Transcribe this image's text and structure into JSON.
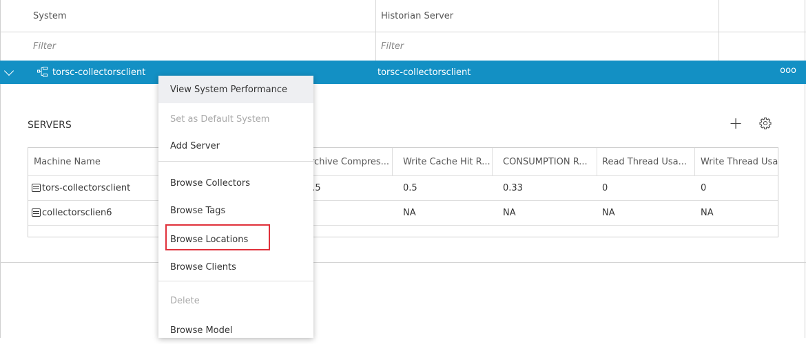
{
  "columns": {
    "system": "System",
    "historian_server": "Historian Server"
  },
  "filters": {
    "system": "Filter",
    "historian_server": "Filter"
  },
  "selected_row": {
    "system": "torsc-collectorsclient",
    "historian_server": "torsc-collectorsclient",
    "more": "ooo"
  },
  "servers": {
    "title": "SERVERS",
    "add_icon": "plus-icon",
    "settings_icon": "gear-icon",
    "headers": [
      "Machine Name",
      "rchive Compres...",
      "Write Cache Hit R...",
      "CONSUMPTION R...",
      "Read Thread Usa...",
      "Write Thread Usa"
    ],
    "rows": [
      {
        "machine": "tors-collectorsclient",
        "cells": [
          "3.5",
          "0.5",
          "0.33",
          "0",
          "0"
        ]
      },
      {
        "machine": "collectorsclien6",
        "cells": [
          "A",
          "NA",
          "NA",
          "NA",
          "NA"
        ]
      }
    ]
  },
  "context_menu": {
    "items": [
      {
        "label": "View System Performance",
        "enabled": true
      },
      {
        "label": "Set as Default System",
        "enabled": false
      },
      {
        "label": "Add Server",
        "enabled": true
      },
      {
        "label": "Browse Collectors",
        "enabled": true
      },
      {
        "label": "Browse Tags",
        "enabled": true
      },
      {
        "label": "Browse Locations",
        "enabled": true
      },
      {
        "label": "Browse Clients",
        "enabled": true
      },
      {
        "label": "Delete",
        "enabled": false
      },
      {
        "label": "Browse Model",
        "enabled": true
      }
    ],
    "highlighted": "Browse Locations",
    "highlight_color": "#e0303a"
  },
  "colors": {
    "selection": "#1390c4"
  }
}
